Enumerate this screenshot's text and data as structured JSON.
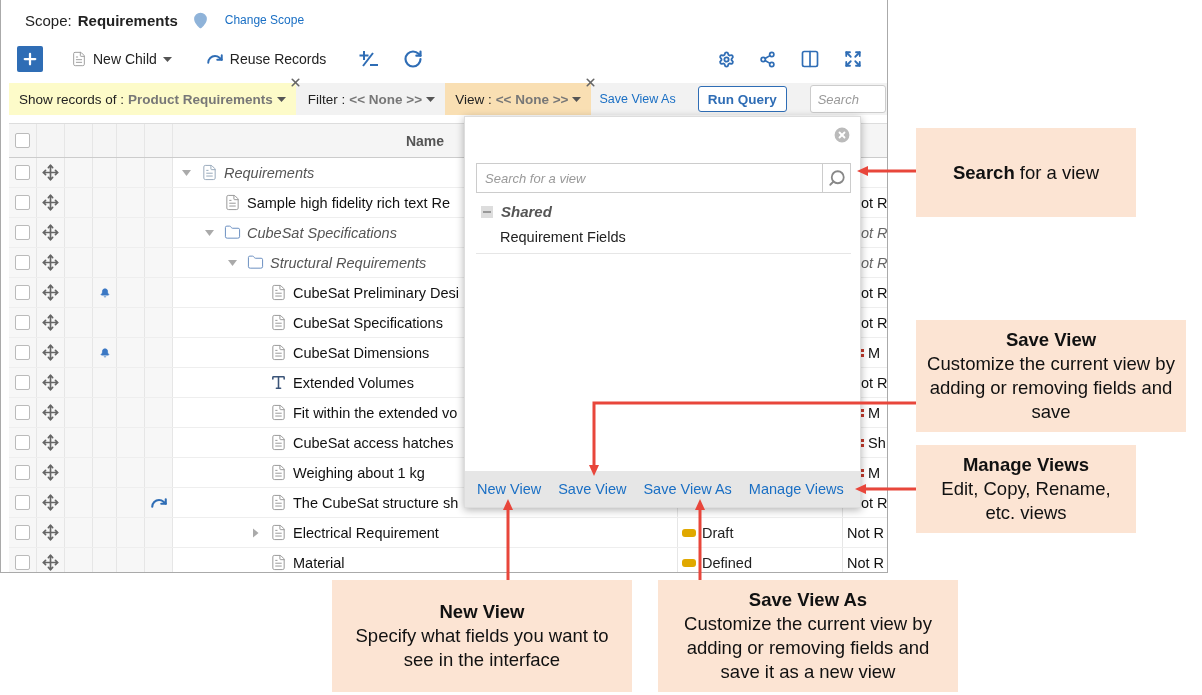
{
  "scope": {
    "label": "Scope:",
    "value": "Requirements",
    "change_link": "Change Scope"
  },
  "toolbar": {
    "new_child": "New Child",
    "reuse_records": "Reuse Records"
  },
  "filter_bar": {
    "show_records": {
      "label": "Show records of :",
      "value": "Product Requirements"
    },
    "filter": {
      "label": "Filter :",
      "value": "<< None >>"
    },
    "view": {
      "label": "View :",
      "value": "<< None >>"
    },
    "save_view_as": "Save View As",
    "run_query": "Run Query",
    "search": {
      "placeholder": "Search"
    }
  },
  "table": {
    "select_all_checked": false,
    "columns": [
      {
        "label": "Name"
      }
    ],
    "tree": [
      {
        "name": "Requirements",
        "kind": "root",
        "expanded": true,
        "checked": false,
        "notification": false,
        "reused": false,
        "priority_mark": false,
        "children": [
          {
            "name": "Sample high fidelity rich text Re",
            "kind": "document",
            "checked": false,
            "notification": false,
            "reused": false,
            "priority_mark": false,
            "column_9": "ot R"
          },
          {
            "name": "CubeSat Specifications",
            "kind": "folder",
            "expanded": true,
            "checked": false,
            "notification": false,
            "reused": false,
            "priority_mark": false,
            "column_9": "ot R",
            "children": [
              {
                "name": "Structural Requirements",
                "kind": "folder",
                "expanded": true,
                "checked": false,
                "notification": false,
                "reused": false,
                "priority_mark": false,
                "column_9": "ot R",
                "children": [
                  {
                    "name": "CubeSat Preliminary Desi",
                    "kind": "document",
                    "checked": false,
                    "notification": true,
                    "reused": false,
                    "priority_mark": false,
                    "column_9": "ot R"
                  },
                  {
                    "name": "CubeSat Specifications",
                    "kind": "document",
                    "checked": false,
                    "notification": false,
                    "reused": false,
                    "priority_mark": false,
                    "column_9": "ot R"
                  },
                  {
                    "name": "CubeSat Dimensions",
                    "kind": "document",
                    "checked": false,
                    "notification": true,
                    "reused": false,
                    "priority_mark": true,
                    "column_9": "M"
                  },
                  {
                    "name": "Extended Volumes",
                    "kind": "text",
                    "checked": false,
                    "notification": false,
                    "reused": false,
                    "priority_mark": false,
                    "column_9": "ot R"
                  },
                  {
                    "name": "Fit within the extended vo",
                    "kind": "document",
                    "checked": false,
                    "notification": false,
                    "reused": false,
                    "priority_mark": true,
                    "column_9": "M"
                  },
                  {
                    "name": "CubeSat access hatches",
                    "kind": "document",
                    "checked": false,
                    "notification": false,
                    "reused": false,
                    "priority_mark": true,
                    "column_9": "Sh"
                  },
                  {
                    "name": "Weighing about 1 kg",
                    "kind": "document",
                    "checked": false,
                    "notification": false,
                    "reused": false,
                    "priority_mark": true,
                    "column_9": "M"
                  },
                  {
                    "name": "The CubeSat structure sh",
                    "kind": "document",
                    "checked": false,
                    "notification": false,
                    "reused": true,
                    "priority_mark": false,
                    "column_9": "ot R"
                  },
                  {
                    "name": "Electrical Requirement",
                    "kind": "document",
                    "expanded": false,
                    "checked": false,
                    "notification": false,
                    "reused": false,
                    "priority_mark": false,
                    "status": "Draft",
                    "column_9": "Not R"
                  },
                  {
                    "name": "Material",
                    "kind": "document",
                    "checked": false,
                    "notification": false,
                    "reused": false,
                    "priority_mark": false,
                    "status": "Defined",
                    "column_9": "Not R"
                  }
                ]
              }
            ]
          }
        ]
      }
    ]
  },
  "view_popup": {
    "search": {
      "placeholder": "Search for a view"
    },
    "groups": [
      {
        "label": "Shared",
        "expanded": true,
        "items": [
          "Requirement Fields"
        ]
      }
    ],
    "actions": [
      "New View",
      "Save View",
      "Save View As",
      "Manage Views"
    ]
  },
  "callouts": [
    {
      "text": "**Search** for a view"
    },
    {
      "title": "Save View",
      "text": "Customize the current view by adding or removing fields and save"
    },
    {
      "title": "Manage Views",
      "text": "Edit, Copy, Rename, etc. views"
    },
    {
      "title": "New View",
      "text": "Specify what fields you want to see in the interface"
    },
    {
      "title": "Save View As",
      "text": "Customize the current view by adding or removing fields and save it as a new view"
    }
  ]
}
